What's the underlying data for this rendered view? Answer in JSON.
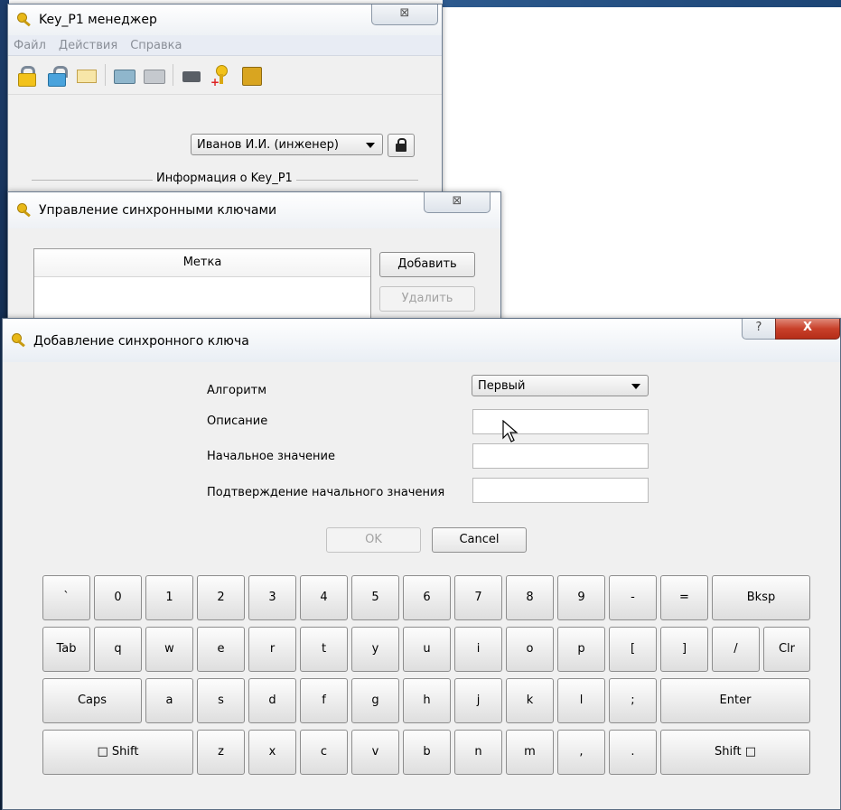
{
  "main_window": {
    "title": "Key_P1 менеджер",
    "close_label": "⊠",
    "menu": [
      "Файл",
      "Действия",
      "Справка"
    ],
    "toolbar_icons": [
      "lock-closed-icon",
      "lock-open-icon",
      "envelope-icon",
      "card-reader-icon",
      "card-reader-grey-icon",
      "usb-reader-icon",
      "key-add-icon",
      "safe-icon"
    ],
    "user_select": "Иванов И.И. (инженер)",
    "section_title": "Информация о Key_P1"
  },
  "sync_window": {
    "title": "Управление синхронными ключами",
    "close_label": "⊠",
    "column_header": "Метка",
    "add_button": "Добавить",
    "delete_button": "Удалить"
  },
  "dialog": {
    "title": "Добавление синхронного ключа",
    "help_label": "?",
    "close_label": "X",
    "fields": {
      "algorithm_label": "Алгоритм",
      "algorithm_value": "Первый",
      "description_label": "Описание",
      "description_value": "",
      "initial_label": "Начальное значение",
      "initial_value": "",
      "confirm_label": "Подтверждение начального значения",
      "confirm_value": ""
    },
    "ok_button": "OK",
    "cancel_button": "Cancel",
    "keyboard": {
      "row1": [
        "`",
        "0",
        "1",
        "2",
        "3",
        "4",
        "5",
        "6",
        "7",
        "8",
        "9",
        "-",
        "=",
        "Bksp"
      ],
      "row2": [
        "Tab",
        "q",
        "w",
        "e",
        "r",
        "t",
        "y",
        "u",
        "i",
        "o",
        "p",
        "[",
        "]",
        "/",
        "Clr"
      ],
      "row3": [
        "Caps",
        "a",
        "s",
        "d",
        "f",
        "g",
        "h",
        "j",
        "k",
        "l",
        ";",
        "Enter"
      ],
      "row4": [
        "□ Shift",
        "z",
        "x",
        "c",
        "v",
        "b",
        "n",
        "m",
        ",",
        ".",
        "Shift □"
      ]
    }
  }
}
